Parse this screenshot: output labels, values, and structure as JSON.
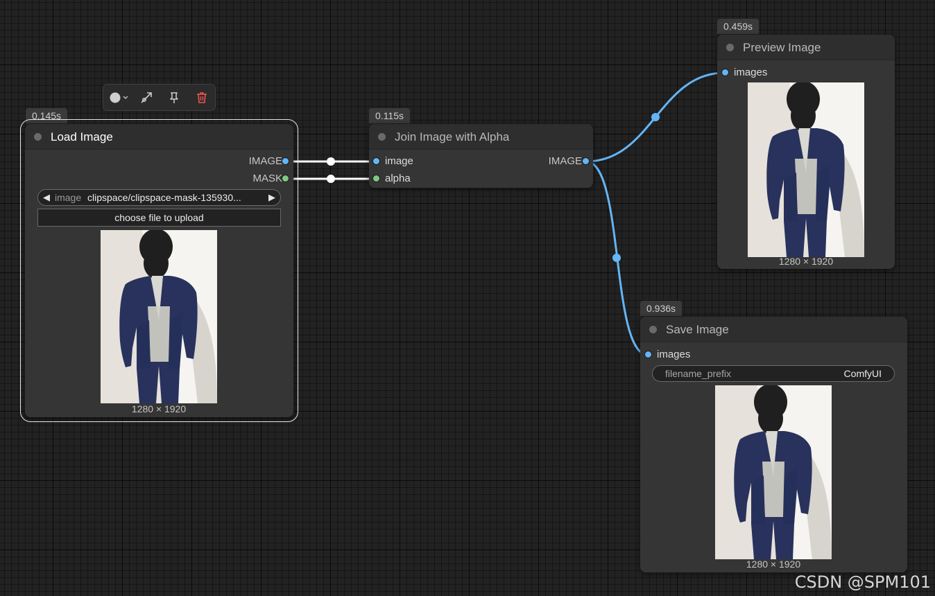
{
  "toolbox": {
    "items": [
      "color-picker-icon",
      "bypass-icon",
      "pin-icon",
      "delete-icon"
    ]
  },
  "nodes": {
    "load_image": {
      "timing": "0.145s",
      "title": "Load Image",
      "outputs": [
        "IMAGE",
        "MASK"
      ],
      "combo_name": "image",
      "combo_value": "clipspace/clipspace-mask-135930...",
      "upload_label": "choose file to upload",
      "dims": "1280 × 1920"
    },
    "join_alpha": {
      "timing": "0.115s",
      "title": "Join Image with Alpha",
      "inputs": [
        "image",
        "alpha"
      ],
      "outputs": [
        "IMAGE"
      ]
    },
    "preview_image": {
      "timing": "0.459s",
      "title": "Preview Image",
      "inputs": [
        "images"
      ],
      "dims": "1280 × 1920"
    },
    "save_image": {
      "timing": "0.936s",
      "title": "Save Image",
      "inputs": [
        "images"
      ],
      "filename_prefix_label": "filename_prefix",
      "filename_prefix_value": "ComfyUI",
      "dims": "1280 × 1920"
    }
  },
  "colors": {
    "image_link": "#64b5f6",
    "mask_link": "#81c784",
    "selected_link": "#ffffff",
    "canvas": "#222222"
  },
  "watermark": "CSDN @SPM101"
}
